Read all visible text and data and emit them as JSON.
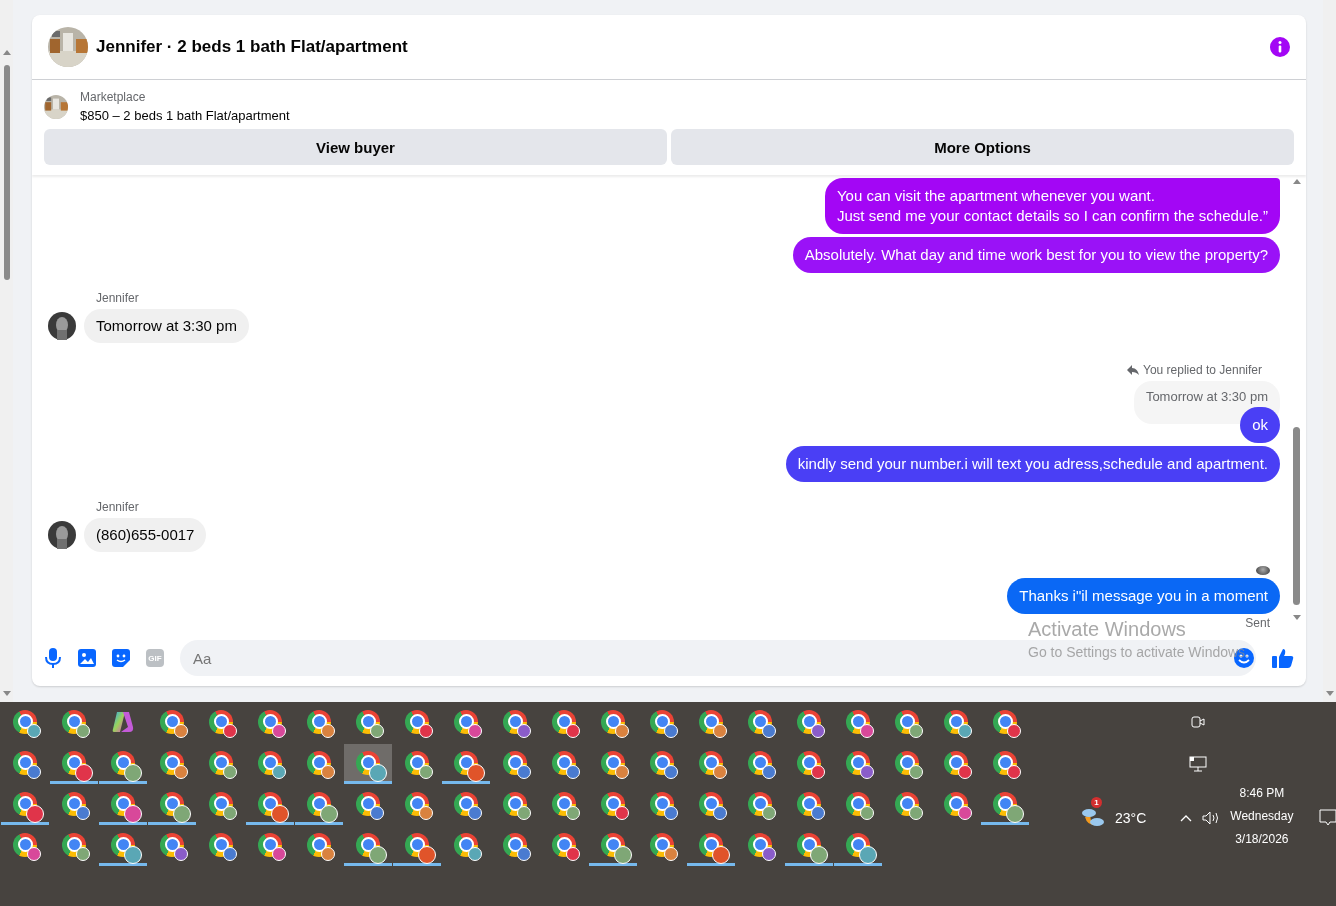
{
  "chat": {
    "title": "Jennifer · 2 beds 1 bath Flat/apartment",
    "listing": {
      "source": "Marketplace",
      "summary": "$850 – 2 beds 1 bath Flat/apartment"
    },
    "actions": [
      "View buyer",
      "More Options"
    ],
    "messages": [
      {
        "kind": "outgoing",
        "text": "You can visit the apartment whenever you want.\nJust send me your contact details so I can confirm the schedule.”",
        "color": "#a306f5"
      },
      {
        "kind": "outgoing",
        "text": "Absolutely. What day and time work best for you to view the property?",
        "color": "#9a12f7"
      },
      {
        "kind": "incoming",
        "sender": "Jennifer",
        "text": "Tomorrow at 3:30 pm"
      },
      {
        "kind": "reply",
        "label": "You replied to Jennifer",
        "quoted": "Tomorrow at 3:30 pm",
        "text": "ok",
        "color": "#4a3ff5"
      },
      {
        "kind": "outgoing",
        "text": "kindly send your number.i will text you adress,schedule and apartment.",
        "color": "#4a3ff5"
      },
      {
        "kind": "incoming",
        "sender": "Jennifer",
        "text": "(860)655-0017"
      },
      {
        "kind": "seen"
      },
      {
        "kind": "outgoing",
        "text": "Thanks i\"il message you in a moment",
        "color": "#0a68f5"
      },
      {
        "kind": "status",
        "text": "Sent"
      }
    ],
    "composer": {
      "gif": "GIF",
      "placeholder": "Aa"
    }
  },
  "os_overlay": {
    "title": "Activate Windows",
    "subtitle": "Go to Settings to activate Windows."
  },
  "taskbar": {
    "rows": [
      [
        {
          "kind": "chrome",
          "color": "#5aa7b5",
          "running": false,
          "selected": false
        },
        {
          "kind": "chrome",
          "color": "#7fa776",
          "running": false,
          "selected": false
        },
        {
          "kind": "copilot",
          "running": false,
          "selected": false
        },
        {
          "kind": "chrome",
          "color": "#d9823f",
          "running": false,
          "selected": false
        },
        {
          "kind": "chrome",
          "color": "#e0344a",
          "running": false,
          "selected": false
        },
        {
          "kind": "chrome",
          "color": "#d8489a",
          "running": false,
          "selected": false
        },
        {
          "kind": "chrome",
          "color": "#d9823f",
          "running": false,
          "selected": false
        },
        {
          "kind": "chrome",
          "color": "#7fa776",
          "running": false,
          "selected": false
        },
        {
          "kind": "chrome",
          "color": "#e0344a",
          "running": false,
          "selected": false
        },
        {
          "kind": "chrome",
          "color": "#d8489a",
          "running": false,
          "selected": false
        },
        {
          "kind": "chrome",
          "color": "#8a5cc9",
          "running": false,
          "selected": false
        },
        {
          "kind": "chrome",
          "color": "#e0344a",
          "running": false,
          "selected": false
        },
        {
          "kind": "chrome",
          "color": "#d9823f",
          "running": false,
          "selected": false
        },
        {
          "kind": "chrome",
          "color": "#4a7bd0",
          "running": false,
          "selected": false
        },
        {
          "kind": "chrome",
          "color": "#d9823f",
          "running": false,
          "selected": false
        },
        {
          "kind": "chrome",
          "color": "#4a7bd0",
          "running": false,
          "selected": false
        },
        {
          "kind": "chrome",
          "color": "#8a5cc9",
          "running": false,
          "selected": false
        },
        {
          "kind": "chrome",
          "color": "#d8489a",
          "running": false,
          "selected": false
        },
        {
          "kind": "chrome",
          "color": "#7fa776",
          "running": false,
          "selected": false
        },
        {
          "kind": "chrome",
          "color": "#5aa7b5",
          "running": false,
          "selected": false
        },
        {
          "kind": "chrome",
          "color": "#e0344a",
          "running": false,
          "selected": false
        }
      ],
      [
        {
          "kind": "chrome",
          "color": "#4a7bd0",
          "running": false,
          "selected": false
        },
        {
          "kind": "chrome",
          "color": "#e0344a",
          "running": true,
          "selected": false
        },
        {
          "kind": "chrome",
          "color": "#7fa776",
          "running": true,
          "selected": false
        },
        {
          "kind": "chrome",
          "color": "#d9823f",
          "running": false,
          "selected": false
        },
        {
          "kind": "chrome",
          "color": "#7fa776",
          "running": false,
          "selected": false
        },
        {
          "kind": "chrome",
          "color": "#5aa7b5",
          "running": false,
          "selected": false
        },
        {
          "kind": "chrome",
          "color": "#d9823f",
          "running": false,
          "selected": false
        },
        {
          "kind": "chrome",
          "color": "#5aa7b5",
          "running": true,
          "selected": true
        },
        {
          "kind": "chrome",
          "color": "#7fa776",
          "running": false,
          "selected": false
        },
        {
          "kind": "chrome",
          "color": "#e0542a",
          "running": true,
          "selected": false
        },
        {
          "kind": "chrome",
          "color": "#4a7bd0",
          "running": false,
          "selected": false
        },
        {
          "kind": "chrome",
          "color": "#4a7bd0",
          "running": false,
          "selected": false
        },
        {
          "kind": "chrome",
          "color": "#d9823f",
          "running": false,
          "selected": false
        },
        {
          "kind": "chrome",
          "color": "#4a7bd0",
          "running": false,
          "selected": false
        },
        {
          "kind": "chrome",
          "color": "#d9823f",
          "running": false,
          "selected": false
        },
        {
          "kind": "chrome",
          "color": "#4a7bd0",
          "running": false,
          "selected": false
        },
        {
          "kind": "chrome",
          "color": "#e0344a",
          "running": false,
          "selected": false
        },
        {
          "kind": "chrome",
          "color": "#8a5cc9",
          "running": false,
          "selected": false
        },
        {
          "kind": "chrome",
          "color": "#7fa776",
          "running": false,
          "selected": false
        },
        {
          "kind": "chrome",
          "color": "#e0344a",
          "running": false,
          "selected": false
        },
        {
          "kind": "chrome",
          "color": "#e0344a",
          "running": false,
          "selected": false
        }
      ],
      [
        {
          "kind": "chrome",
          "color": "#e0344a",
          "running": true,
          "selected": false
        },
        {
          "kind": "chrome",
          "color": "#4a7bd0",
          "running": false,
          "selected": false
        },
        {
          "kind": "chrome",
          "color": "#d8489a",
          "running": true,
          "selected": false
        },
        {
          "kind": "chrome",
          "color": "#7fa776",
          "running": true,
          "selected": false
        },
        {
          "kind": "chrome",
          "color": "#7fa776",
          "running": false,
          "selected": false
        },
        {
          "kind": "chrome",
          "color": "#e0542a",
          "running": true,
          "selected": false
        },
        {
          "kind": "chrome",
          "color": "#7fa776",
          "running": true,
          "selected": false
        },
        {
          "kind": "chrome",
          "color": "#4a7bd0",
          "running": false,
          "selected": false
        },
        {
          "kind": "chrome",
          "color": "#d9823f",
          "running": false,
          "selected": false
        },
        {
          "kind": "chrome",
          "color": "#4a7bd0",
          "running": false,
          "selected": false
        },
        {
          "kind": "chrome",
          "color": "#7fa776",
          "running": false,
          "selected": false
        },
        {
          "kind": "chrome",
          "color": "#7fa776",
          "running": false,
          "selected": false
        },
        {
          "kind": "chrome",
          "color": "#e0344a",
          "running": false,
          "selected": false
        },
        {
          "kind": "chrome",
          "color": "#4a7bd0",
          "running": false,
          "selected": false
        },
        {
          "kind": "chrome",
          "color": "#4a7bd0",
          "running": false,
          "selected": false
        },
        {
          "kind": "chrome",
          "color": "#7fa776",
          "running": false,
          "selected": false
        },
        {
          "kind": "chrome",
          "color": "#4a7bd0",
          "running": false,
          "selected": false
        },
        {
          "kind": "chrome",
          "color": "#7fa776",
          "running": false,
          "selected": false
        },
        {
          "kind": "chrome",
          "color": "#7fa776",
          "running": false,
          "selected": false
        },
        {
          "kind": "chrome",
          "color": "#d8489a",
          "running": false,
          "selected": false
        },
        {
          "kind": "chrome",
          "color": "#7fa776",
          "running": true,
          "selected": false
        }
      ],
      [
        {
          "kind": "chrome",
          "color": "#d8489a",
          "running": false,
          "selected": false
        },
        {
          "kind": "chrome",
          "color": "#7fa776",
          "running": false,
          "selected": false
        },
        {
          "kind": "chrome",
          "color": "#5aa7b5",
          "running": true,
          "selected": false
        },
        {
          "kind": "chrome",
          "color": "#8a5cc9",
          "running": false,
          "selected": false
        },
        {
          "kind": "chrome",
          "color": "#4a7bd0",
          "running": false,
          "selected": false
        },
        {
          "kind": "chrome",
          "color": "#d8489a",
          "running": false,
          "selected": false
        },
        {
          "kind": "chrome",
          "color": "#d9823f",
          "running": false,
          "selected": false
        },
        {
          "kind": "chrome",
          "color": "#7fa776",
          "running": true,
          "selected": false
        },
        {
          "kind": "chrome",
          "color": "#e0542a",
          "running": true,
          "selected": false
        },
        {
          "kind": "chrome",
          "color": "#5aa7b5",
          "running": false,
          "selected": false
        },
        {
          "kind": "chrome",
          "color": "#4a7bd0",
          "running": false,
          "selected": false
        },
        {
          "kind": "chrome",
          "color": "#e0344a",
          "running": false,
          "selected": false
        },
        {
          "kind": "chrome",
          "color": "#7fa776",
          "running": true,
          "selected": false
        },
        {
          "kind": "chrome",
          "color": "#d9823f",
          "running": false,
          "selected": false
        },
        {
          "kind": "chrome",
          "color": "#e0542a",
          "running": true,
          "selected": false
        },
        {
          "kind": "chrome",
          "color": "#8a5cc9",
          "running": false,
          "selected": false
        },
        {
          "kind": "chrome",
          "color": "#7fa776",
          "running": true,
          "selected": false
        },
        {
          "kind": "chrome",
          "color": "#5aa7b5",
          "running": true,
          "selected": false
        }
      ]
    ],
    "weather": {
      "badge": "1",
      "temperature": "23°C"
    },
    "clock": {
      "time": "8:46 PM",
      "day": "Wednesday",
      "date": "3/18/2026"
    }
  }
}
